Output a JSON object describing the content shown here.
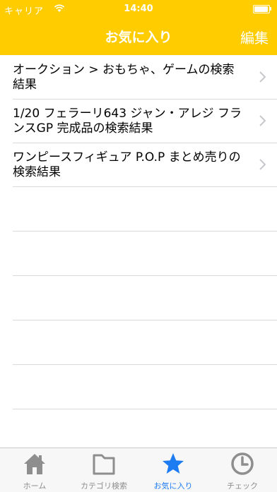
{
  "status": {
    "carrier": "キャリア",
    "time": "14:40"
  },
  "nav": {
    "title": "お気に入り",
    "edit_label": "編集"
  },
  "favorites": [
    {
      "label": "オークション > おもちゃ、ゲームの検索結果"
    },
    {
      "label": "1/20 フェラーリ643 ジャン・アレジ フランスGP 完成品の検索結果"
    },
    {
      "label": "ワンピースフィギュア P.O.P まとめ売りの検索結果"
    }
  ],
  "tabs": [
    {
      "label": "ホーム",
      "icon": "home-icon"
    },
    {
      "label": "カテゴリ検索",
      "icon": "folder-icon"
    },
    {
      "label": "お気に入り",
      "icon": "star-icon",
      "active": true
    },
    {
      "label": "チェック",
      "icon": "clock-icon"
    }
  ],
  "colors": {
    "header": "#ffcc00",
    "active_tab": "#1e7cf2",
    "inactive_tab": "#8e8e8e"
  }
}
